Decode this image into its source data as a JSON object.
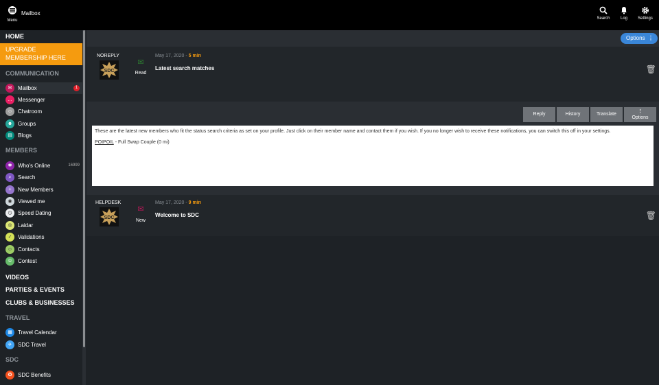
{
  "topbar": {
    "app_title": "Mailbox",
    "menu_label": "Menu",
    "actions": [
      {
        "label": "Search",
        "icon": "search-icon"
      },
      {
        "label": "Log",
        "icon": "bell-icon"
      },
      {
        "label": "Settings",
        "icon": "gear-icon"
      }
    ]
  },
  "sidebar": {
    "home": "HOME",
    "upgrade": "UPGRADE MEMBERSHIP HERE",
    "communication": "COMMUNICATION",
    "comm_items": [
      {
        "label": "Mailbox",
        "badge": "1",
        "color": "#c2185b",
        "glyph": "✉"
      },
      {
        "label": "Messenger",
        "color": "#e91e63",
        "glyph": "…"
      },
      {
        "label": "Chatroom",
        "color": "#9e9e9e",
        "glyph": "☺"
      },
      {
        "label": "Groups",
        "color": "#26a69a",
        "glyph": "☻"
      },
      {
        "label": "Blogs",
        "color": "#00897b",
        "glyph": "▤"
      }
    ],
    "members": "MEMBERS",
    "member_items": [
      {
        "label": "Who's Online",
        "count": "16999",
        "color": "#8e24aa",
        "glyph": "✱"
      },
      {
        "label": "Search",
        "color": "#7e57c2",
        "glyph": "⌕"
      },
      {
        "label": "New Members",
        "color": "#9575cd",
        "glyph": "+"
      },
      {
        "label": "Viewed me",
        "color": "#cfd8dc",
        "glyph": "◉"
      },
      {
        "label": "Speed Dating",
        "color": "#eceff1",
        "glyph": "◷"
      },
      {
        "label": "Laidar",
        "color": "#dce775",
        "glyph": "◎"
      },
      {
        "label": "Validations",
        "color": "#d4e157",
        "glyph": "✓"
      },
      {
        "label": "Contacts",
        "color": "#9ccc65",
        "glyph": "☺"
      },
      {
        "label": "Contest",
        "color": "#66bb6a",
        "glyph": "♔"
      }
    ],
    "videos": "VIDEOS",
    "parties": "PARTIES & EVENTS",
    "clubs": "CLUBS & BUSINESSES",
    "travel": "TRAVEL",
    "travel_items": [
      {
        "label": "Travel Calendar",
        "color": "#1e88e5",
        "glyph": "▦"
      },
      {
        "label": "SDC Travel",
        "color": "#42a5f5",
        "glyph": "✈"
      }
    ],
    "sdc": "SDC",
    "sdc_items": [
      {
        "label": "SDC Benefits",
        "color": "#f4511e",
        "glyph": "✪"
      }
    ]
  },
  "main": {
    "options_label": "Options",
    "messages": [
      {
        "sender": "NOREPLY",
        "status": "Read",
        "date": "May 17, 2020 - ",
        "age": "5 min",
        "subject": "Latest search matches",
        "env_color": "#2e7d32"
      },
      {
        "sender": "HELPDESK",
        "status": "New",
        "date": "May 17, 2020 - ",
        "age": "9 min",
        "subject": "Welcome to SDC",
        "env_color": "#c2185b"
      }
    ],
    "actions": {
      "reply": "Reply",
      "history": "History",
      "translate": "Translate",
      "options": "Options"
    },
    "body": {
      "text": "These are the latest new members who fit the status search criteria as set on your profile. Just click on their member name and contact them if you wish. If you no longer wish to receive these notifications, you can switch this off in your settings.",
      "member_name": "POIPOIL",
      "member_desc": " - Full Swap Couple   (0 mi)"
    },
    "avatar_text": "SDC"
  }
}
